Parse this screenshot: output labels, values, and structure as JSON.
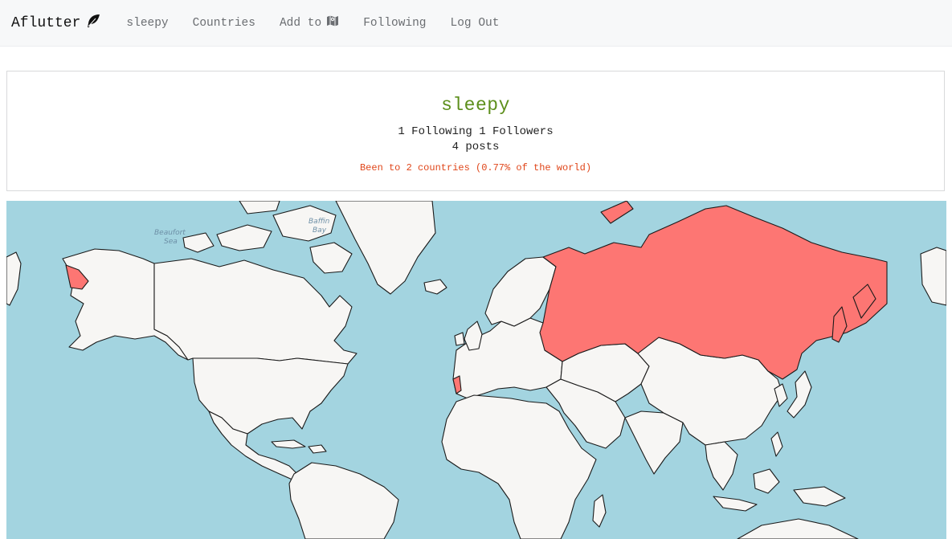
{
  "nav": {
    "brand": "Aflutter",
    "brand_icon": "feather-icon",
    "items": [
      {
        "label": "sleepy"
      },
      {
        "label": "Countries"
      },
      {
        "label": "Add to",
        "icon": "map-icon"
      },
      {
        "label": "Following"
      },
      {
        "label": "Log Out"
      }
    ]
  },
  "profile": {
    "username": "sleepy",
    "follow_line": "1 Following 1 Followers",
    "posts_line": "4 posts",
    "been_line": "Been to 2 countries (0.77% of the world)"
  },
  "map": {
    "labels": [
      "Beaufort",
      "Sea",
      "Baffin",
      "Bay"
    ],
    "visited_countries": [
      "Russia",
      "Portugal"
    ],
    "colors": {
      "ocean": "#a3d4e0",
      "land": "#f7f6f4",
      "visited": "#fd7673",
      "username": "#5d8f1c",
      "been": "#e0461a"
    }
  }
}
